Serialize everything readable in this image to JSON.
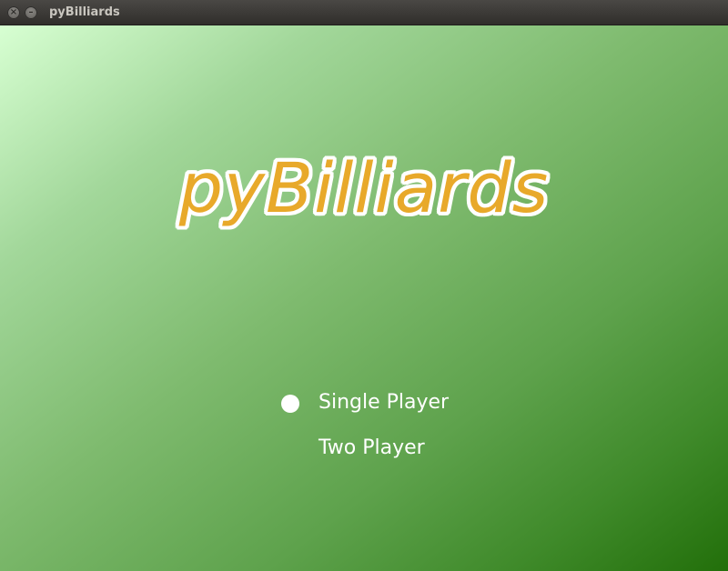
{
  "window": {
    "title": "pyBilliards",
    "close_icon": "×",
    "minimize_icon": "–"
  },
  "game": {
    "title": "pyBilliards",
    "title_color": "#e8a92a",
    "outline_color": "#ffffff"
  },
  "menu": {
    "selected_index": 0,
    "items": [
      {
        "label": "Single Player"
      },
      {
        "label": "Two Player"
      }
    ]
  }
}
